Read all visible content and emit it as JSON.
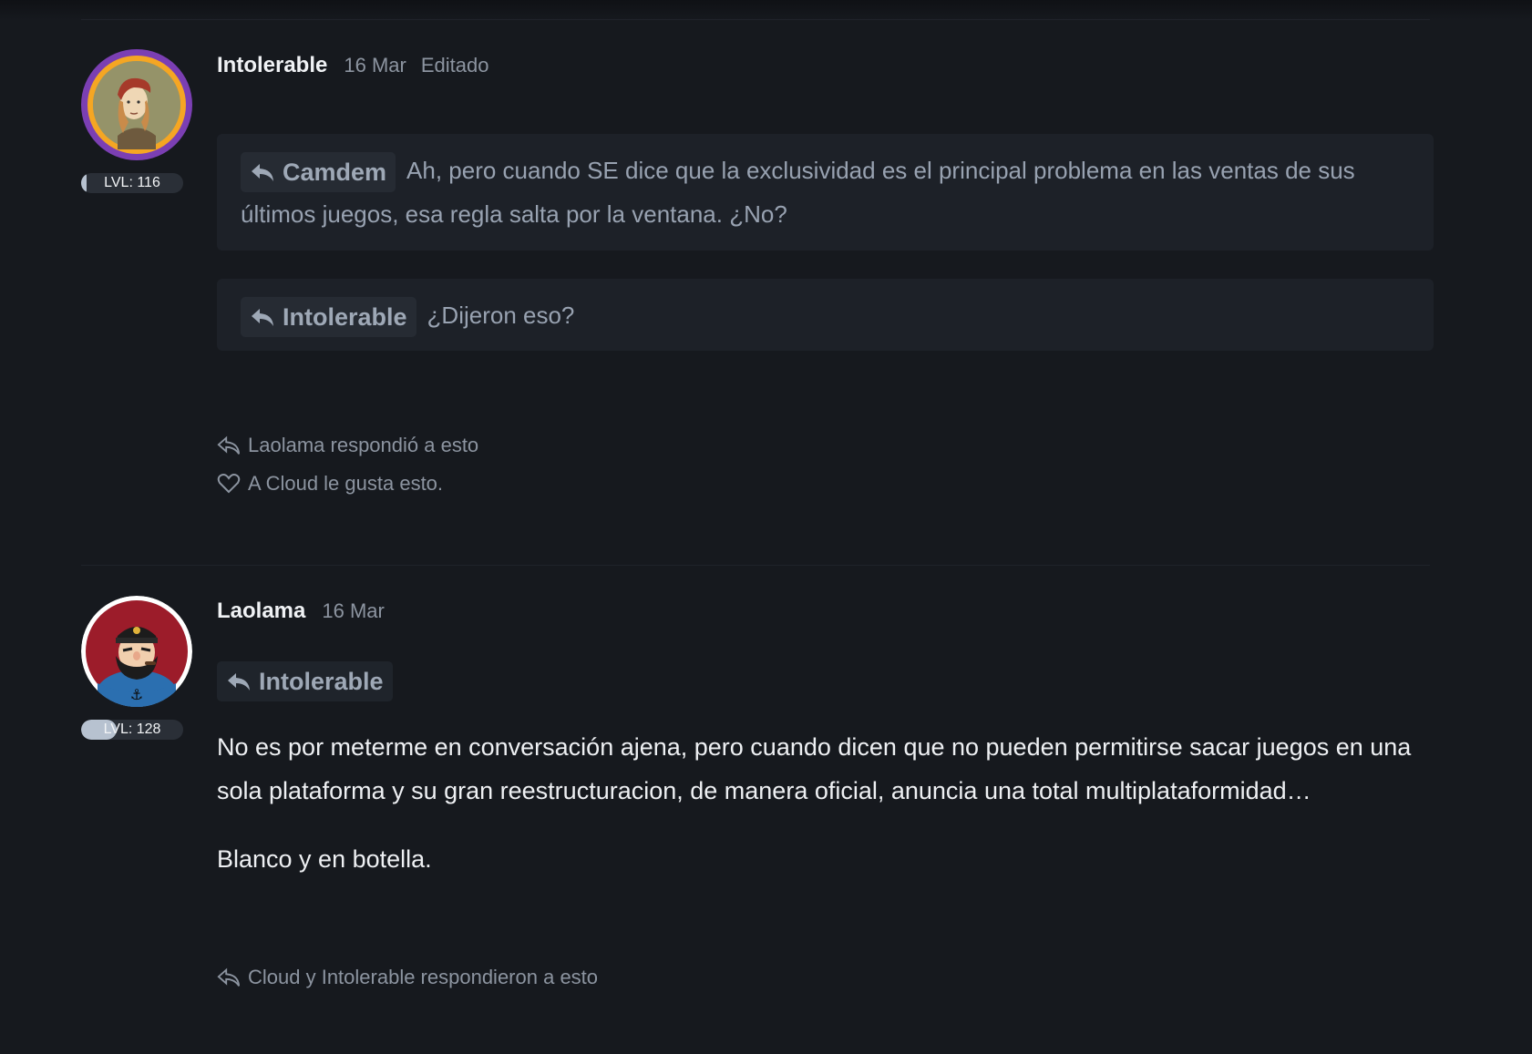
{
  "posts": [
    {
      "author": "Intolerable",
      "date": "16 Mar",
      "edited": "Editado",
      "level": "LVL: 116",
      "level_fraction": 0.05,
      "avatar_ring_color": "#f5a623",
      "avatar_outer_color": "#7b3fb3",
      "quotes": [
        {
          "user": "Camdem",
          "text": "Ah, pero cuando SE dice que la exclusividad es el principal problema en las ventas de sus últimos juegos, esa regla salta por la ventana. ¿No?"
        },
        {
          "user": "Intolerable",
          "text": "¿Dijeron eso?"
        }
      ],
      "reactions": [
        {
          "icon": "reply-icon",
          "text": "Laolama respondió a esto"
        },
        {
          "icon": "heart-icon",
          "text": "A Cloud le gusta esto."
        }
      ]
    },
    {
      "author": "Laolama",
      "date": "16 Mar",
      "level": "LVL: 128",
      "level_fraction": 0.35,
      "reply_to": "Intolerable",
      "paragraphs": [
        "No es por meterme en conversación ajena, pero cuando dicen que no pueden permitirse sacar juegos en una sola plataforma y su gran reestructuracion, de manera oficial, anuncia una total multiplataformidad…",
        "Blanco y en botella."
      ],
      "reactions": [
        {
          "icon": "reply-icon",
          "text": "Cloud y Intolerable respondieron a esto"
        }
      ]
    }
  ]
}
